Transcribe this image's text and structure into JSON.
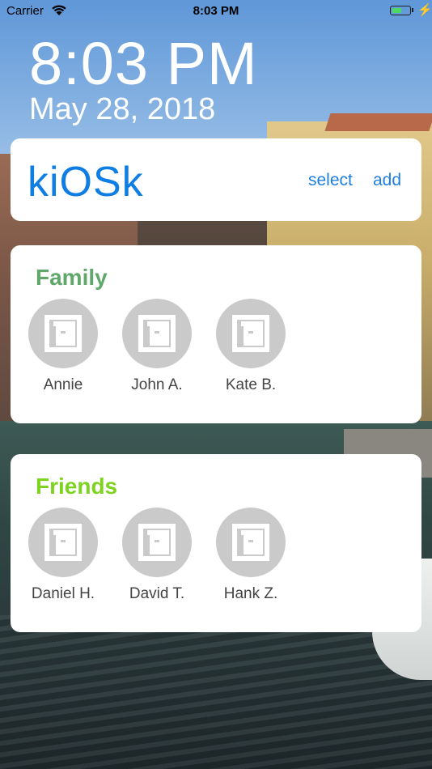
{
  "status_bar": {
    "carrier": "Carrier",
    "time": "8:03 PM",
    "battery_level": 0.55,
    "icons": [
      "wifi-icon",
      "battery-icon",
      "charging-bolt-icon"
    ]
  },
  "lock_clock": {
    "time": "8:03 PM",
    "date": "May 28, 2018"
  },
  "header": {
    "title": "kiOSk",
    "select_label": "select",
    "add_label": "add"
  },
  "groups": [
    {
      "title": "Family",
      "title_color": "#5fa86a",
      "contacts": [
        {
          "name": "Annie",
          "icon": "placeholder-avatar-icon"
        },
        {
          "name": "John A.",
          "icon": "placeholder-avatar-icon"
        },
        {
          "name": "Kate B.",
          "icon": "placeholder-avatar-icon"
        }
      ]
    },
    {
      "title": "Friends",
      "title_color": "#7ed321",
      "contacts": [
        {
          "name": "Daniel H.",
          "icon": "placeholder-avatar-icon"
        },
        {
          "name": "David T.",
          "icon": "placeholder-avatar-icon"
        },
        {
          "name": "Hank Z.",
          "icon": "placeholder-avatar-icon"
        }
      ]
    }
  ],
  "colors": {
    "accent": "#1e7fe2",
    "card_bg": "#ffffff",
    "avatar_bg": "#cbcaca"
  }
}
